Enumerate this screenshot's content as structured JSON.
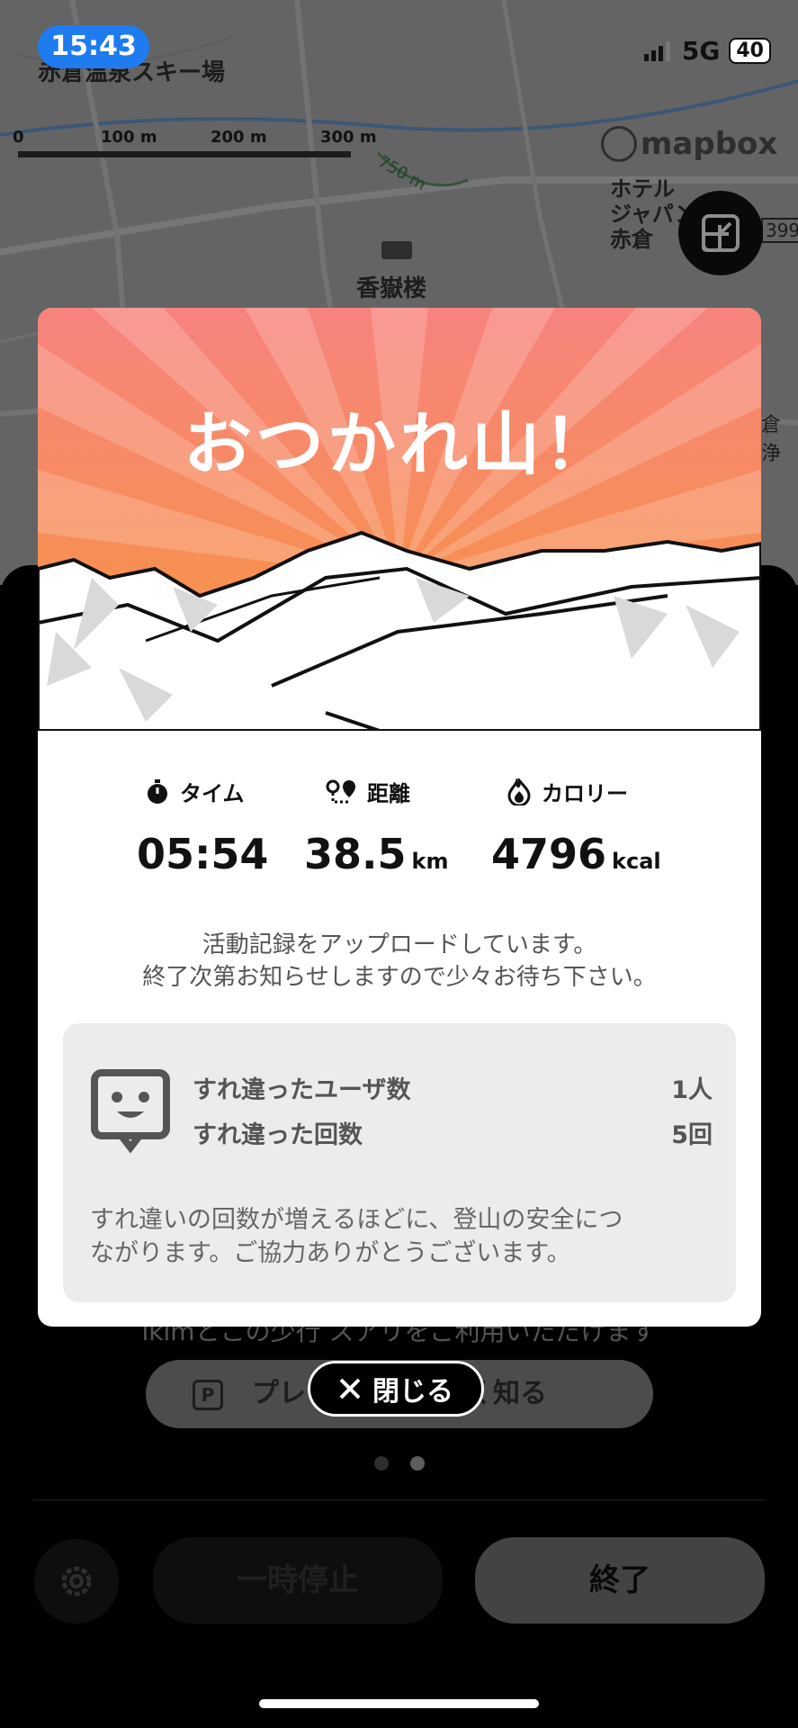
{
  "status_bar": {
    "time": "15:43",
    "network": "5G",
    "battery": "40"
  },
  "map": {
    "labels": [
      "赤倉温泉スキー場",
      "香嶽楼",
      "ホテル",
      "ジャパン",
      "赤倉",
      "倉浄",
      "399"
    ],
    "scale": [
      "0",
      "100 m",
      "200 m",
      "300 m"
    ],
    "contour": "750 m",
    "attribution": "mapbox"
  },
  "background_panel": {
    "promo_text": "ikimとこの少行 スアリをご利用いただけます",
    "premium_button": "プレミアムを詳しく知る",
    "pause_button": "一時停止",
    "end_button": "終了"
  },
  "modal": {
    "title": "おつかれ山！",
    "stats": [
      {
        "label": "タイム",
        "value": "05:54",
        "unit": ""
      },
      {
        "label": "距離",
        "value": "38.5",
        "unit": "km"
      },
      {
        "label": "カロリー",
        "value": "4796",
        "unit": "kcal"
      }
    ],
    "notice_line1": "活動記録をアップロードしています。",
    "notice_line2": "終了次第お知らせしますので少々お待ち下さい。",
    "passes": {
      "users_label": "すれ違ったユーザ数",
      "users_value": "1人",
      "count_label": "すれ違った回数",
      "count_value": "5回",
      "note_line1": "すれ違いの回数が増えるほどに、登山の安全につ",
      "note_line2": "ながります。ご協力ありがとうございます。"
    },
    "close_button": "閉じる"
  },
  "colors": {
    "hero_top": "#f7837e",
    "hero_bottom": "#f7973a",
    "accent_blue": "#1e7bf0"
  }
}
